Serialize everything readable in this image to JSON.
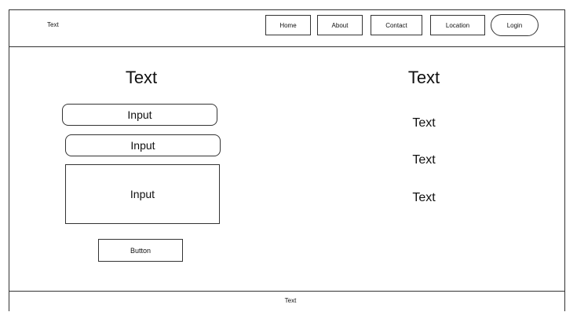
{
  "header": {
    "brand": "Text",
    "nav": [
      "Home",
      "About",
      "Contact",
      "Location"
    ],
    "login_label": "Login"
  },
  "left": {
    "title": "Text",
    "input1": "Input",
    "input2": "Input",
    "textarea": "Input",
    "button_label": "Button"
  },
  "right": {
    "title": "Text",
    "lines": [
      "Text",
      "Text",
      "Text"
    ]
  },
  "footer": {
    "text": "Text"
  }
}
